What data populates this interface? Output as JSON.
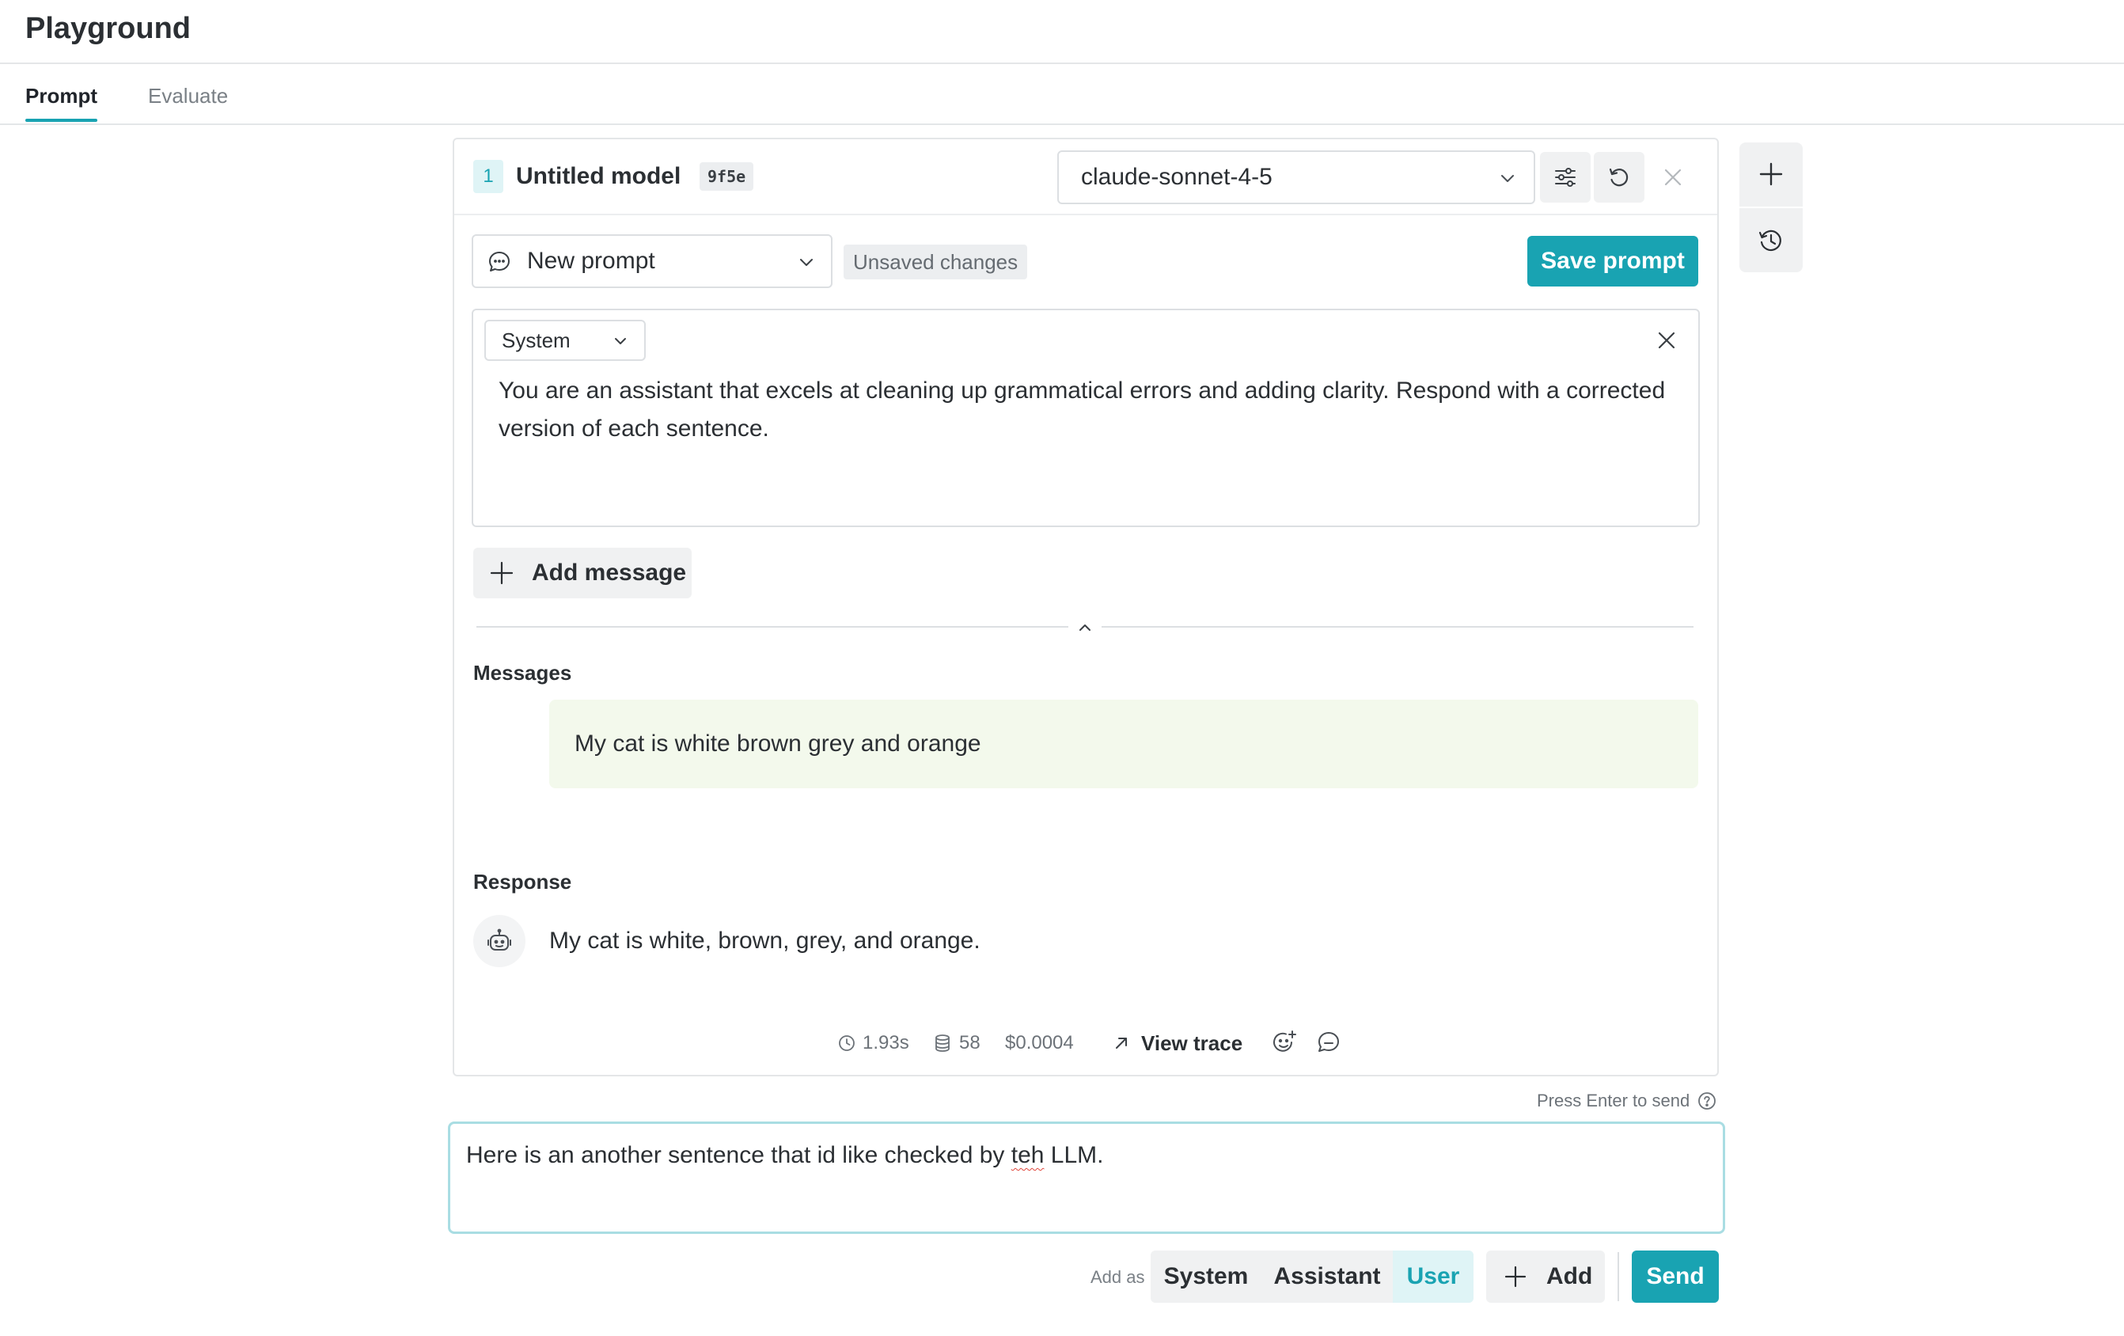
{
  "app": {
    "title": "Playground"
  },
  "tabs": [
    {
      "label": "Prompt",
      "active": true
    },
    {
      "label": "Evaluate",
      "active": false
    }
  ],
  "model_panel": {
    "index": "1",
    "name": "Untitled model",
    "hash": "9f5e",
    "model": "claude-sonnet-4-5"
  },
  "prompt": {
    "selected": "New prompt",
    "status_badge": "Unsaved changes",
    "save_label": "Save prompt"
  },
  "system_message": {
    "role": "System",
    "text": "You are an assistant that excels at cleaning up grammatical errors and adding clarity. Respond with a corrected version of each sentence."
  },
  "add_message_label": "Add message",
  "messages": {
    "heading": "Messages",
    "items": [
      {
        "role": "user",
        "text": "My cat is white brown grey and orange"
      }
    ]
  },
  "response": {
    "heading": "Response",
    "text": "My cat is white, brown, grey, and orange."
  },
  "metrics": {
    "latency": "1.93s",
    "tokens": "58",
    "cost": "$0.0004",
    "view_trace": "View trace"
  },
  "composer": {
    "hint": "Press Enter to send",
    "text_before": "Here is an another sentence that id like checked by ",
    "misspelled_word": "teh",
    "text_after": " LLM."
  },
  "footer": {
    "add_as_label": "Add as",
    "roles": [
      "System",
      "Assistant",
      "User"
    ],
    "selected_role": "User",
    "add_label": "Add",
    "send_label": "Send"
  },
  "colors": {
    "accent": "#19a3b2",
    "accent_light": "#dff4f6",
    "message_bg": "#f3f9ec",
    "border": "#dcdfe2"
  }
}
